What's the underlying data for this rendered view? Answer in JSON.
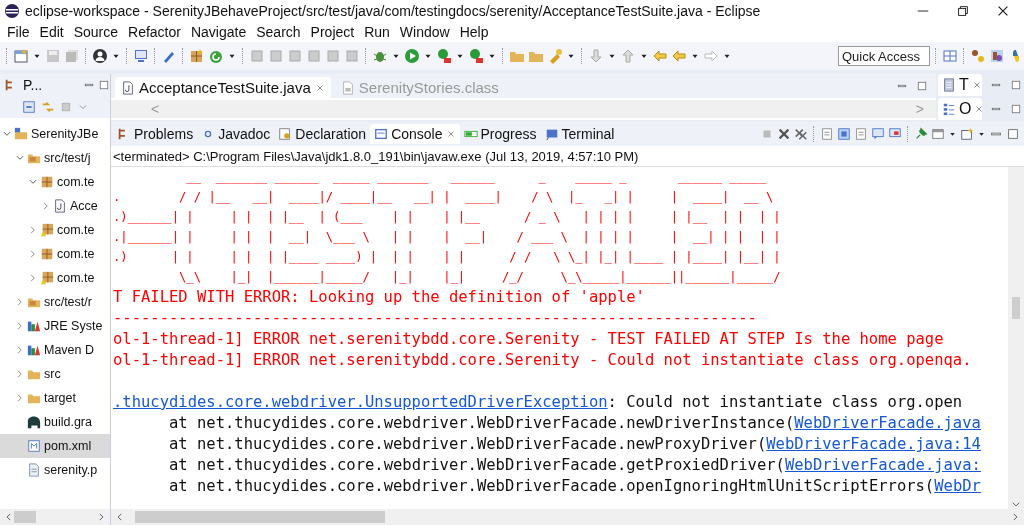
{
  "window": {
    "title": "eclipse-workspace - SerenityJBehaveProject/src/test/java/com/testingdocs/serenity/AcceptanceTestSuite.java - Eclipse"
  },
  "menu": [
    "File",
    "Edit",
    "Source",
    "Refactor",
    "Navigate",
    "Search",
    "Project",
    "Run",
    "Window",
    "Help"
  ],
  "quick_access": {
    "placeholder": "Quick Access"
  },
  "explorer": {
    "tab": {
      "label": "P...",
      "selected": true
    },
    "tree": [
      {
        "label": "SerenityJBe",
        "kind": "project",
        "expanded": true,
        "selected": false,
        "children": [
          {
            "label": "src/test/j",
            "kind": "source-folder",
            "expanded": true,
            "selected": false,
            "children": [
              {
                "label": "com.te",
                "kind": "package",
                "expanded": true,
                "selected": false,
                "children": [
                  {
                    "label": "Acce",
                    "kind": "java-file",
                    "expanded": false,
                    "selected": false
                  }
                ]
              },
              {
                "label": "com.te",
                "kind": "package-warning",
                "expanded": false,
                "selected": false
              },
              {
                "label": "com.te",
                "kind": "package",
                "expanded": false,
                "selected": false
              },
              {
                "label": "com.te",
                "kind": "package-warning",
                "expanded": false,
                "selected": false
              }
            ]
          },
          {
            "label": "src/test/r",
            "kind": "source-folder",
            "expanded": false,
            "selected": false
          },
          {
            "label": "JRE Syste",
            "kind": "library",
            "expanded": false,
            "selected": false
          },
          {
            "label": "Maven D",
            "kind": "library",
            "expanded": false,
            "selected": false
          },
          {
            "label": "src",
            "kind": "folder",
            "expanded": false,
            "selected": false
          },
          {
            "label": "target",
            "kind": "folder",
            "expanded": false,
            "selected": false
          },
          {
            "label": "build.gra",
            "kind": "gradle-file",
            "selected": false
          },
          {
            "label": "pom.xml",
            "kind": "maven-file",
            "selected": true
          },
          {
            "label": "serenity.p",
            "kind": "file",
            "selected": false
          }
        ]
      }
    ]
  },
  "editor": {
    "tabs": [
      {
        "label": "AcceptanceTestSuite.java",
        "selected": true
      },
      {
        "label": "SerenityStories.class",
        "selected": false
      }
    ],
    "breadcrumb": {
      "left": "<",
      "right": ">"
    }
  },
  "side_tabs": [
    {
      "label": "T",
      "selected": true
    },
    {
      "label": "O",
      "selected": true
    }
  ],
  "console": {
    "tabs": [
      {
        "label": "Problems",
        "selected": false
      },
      {
        "label": "Javadoc",
        "selected": false
      },
      {
        "label": "Declaration",
        "selected": false
      },
      {
        "label": "Console",
        "selected": true
      },
      {
        "label": "Progress",
        "selected": false
      },
      {
        "label": "Terminal",
        "selected": false
      }
    ],
    "header": "<terminated> C:\\Program Files\\Java\\jdk1.8.0_191\\bin\\javaw.exe (Jul 13, 2019, 4:57:10 PM)",
    "lines": [
      {
        "kind": "art",
        "text": "          __  _______ ______  _____ _______   ______      _    _____ _       ______ _____"
      },
      {
        "kind": "art",
        "text": ".        / / |__   __|  ____|/ ____|__   __| |  ____|    / \\  |_   _| |     |  ____|  __ \\"
      },
      {
        "kind": "art",
        "text": ".)______| |     | |  | |__  | (___    | |    | |__      / _ \\   | | | |     | |__  | |  | |"
      },
      {
        "kind": "art",
        "text": ".|______| |     | |  |  __|  \\___ \\   | |    |  __|    / ___ \\  | | | |     |  __| | |  | |"
      },
      {
        "kind": "art",
        "text": ".)      | |     | |  | |____ ____) |  | |    | |      / /   \\ \\_| |_| |____ | |____| |__| |"
      },
      {
        "kind": "art",
        "text": "         \\_\\    |_|  |______|_____/   |_|    |_|     /_/     \\_\\_____|______||______|_____/"
      },
      {
        "kind": "error",
        "text": "T FAILED WITH ERROR: Looking up the definition of 'apple'"
      },
      {
        "kind": "error",
        "text": "---------------------------------------------------------------------"
      },
      {
        "kind": "error",
        "text": "ol-1-thread-1] ERROR net.serenitybdd.core.Serenity - TEST FAILED AT STEP Is the home page"
      },
      {
        "kind": "error",
        "text": "ol-1-thread-1] ERROR net.serenitybdd.core.Serenity - Could not instantiate class org.openqa."
      },
      {
        "kind": "blank"
      },
      {
        "kind": "exception",
        "link": ".thucydides.core.webdriver.UnsupportedDriverException",
        "text": ": Could not instantiate class org.open"
      },
      {
        "kind": "stack",
        "text": "at net.thucydides.core.webdriver.WebDriverFacade.newDriverInstance(",
        "link": "WebDriverFacade.java"
      },
      {
        "kind": "stack",
        "text": "at net.thucydides.core.webdriver.WebDriverFacade.newProxyDriver(",
        "link": "WebDriverFacade.java:14"
      },
      {
        "kind": "stack",
        "text": "at net.thucydides.core.webdriver.WebDriverFacade.getProxiedDriver(",
        "link": "WebDriverFacade.java:"
      },
      {
        "kind": "stack",
        "text": "at net.thucydides.core.webdriver.WebDriverFacade.openIgnoringHtmlUnitScriptErrors(",
        "link": "WebDr"
      }
    ]
  }
}
